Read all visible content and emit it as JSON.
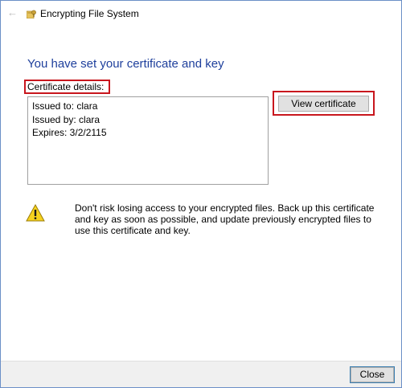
{
  "window": {
    "title": "Encrypting File System",
    "back_icon": "back-arrow-icon",
    "app_icon": "encrypting-file-system-icon"
  },
  "main": {
    "heading": "You have set your certificate and key",
    "details_label": "Certificate details:",
    "details": {
      "issued_to": "Issued to: clara",
      "issued_by": "Issued by: clara",
      "expires": "Expires: 3/2/2115"
    },
    "view_certificate_label": "View certificate",
    "warning_icon": "warning-icon",
    "warning_text": "Don't risk losing access to your encrypted files. Back up this certificate and key as soon as possible, and update previously encrypted files to use this certificate and key."
  },
  "footer": {
    "close_label": "Close"
  },
  "colors": {
    "heading": "#1e3f9c",
    "highlight_box": "#c8161d",
    "window_border": "#6b8fc7",
    "footer_bg": "#f0f0f0"
  }
}
